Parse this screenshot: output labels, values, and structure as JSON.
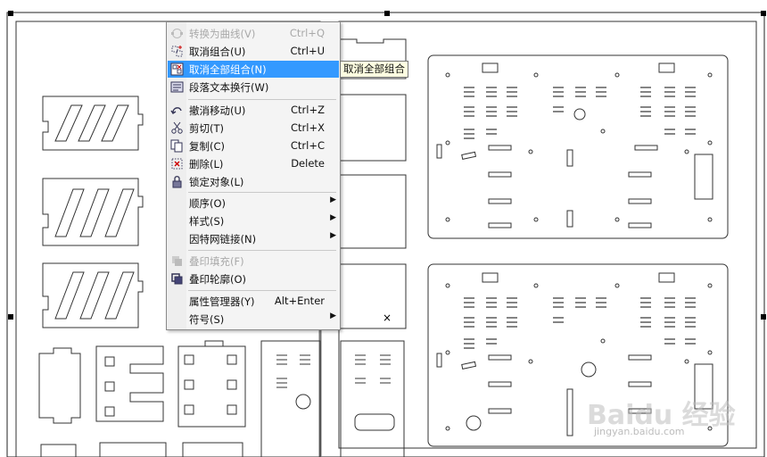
{
  "context_menu": {
    "items": [
      {
        "label": "转换为曲线(V)",
        "shortcut": "Ctrl+Q",
        "icon": "convert-curve-icon",
        "disabled": true
      },
      {
        "label": "取消组合(U)",
        "shortcut": "Ctrl+U",
        "icon": "ungroup-icon"
      },
      {
        "label": "取消全部组合(N)",
        "shortcut": "",
        "icon": "ungroup-all-icon",
        "highlighted": true
      },
      {
        "label": "段落文本换行(W)",
        "shortcut": "",
        "icon": "wrap-text-icon"
      },
      {
        "label": "撤消移动(U)",
        "shortcut": "Ctrl+Z",
        "icon": "undo-icon"
      },
      {
        "label": "剪切(T)",
        "shortcut": "Ctrl+X",
        "icon": "scissors-icon"
      },
      {
        "label": "复制(C)",
        "shortcut": "Ctrl+C",
        "icon": "copy-icon"
      },
      {
        "label": "删除(L)",
        "shortcut": "Delete",
        "icon": "delete-icon"
      },
      {
        "label": "锁定对象(L)",
        "shortcut": "",
        "icon": "lock-icon"
      },
      {
        "label": "顺序(O)",
        "submenu": true
      },
      {
        "label": "样式(S)",
        "submenu": true
      },
      {
        "label": "因特网链接(N)",
        "submenu": true
      },
      {
        "label": "叠印填充(F)",
        "shortcut": "",
        "icon": "overprint-fill-icon",
        "disabled": true
      },
      {
        "label": "叠印轮廓(O)",
        "shortcut": "",
        "icon": "overprint-outline-icon"
      },
      {
        "label": "属性管理器(Y)",
        "shortcut": "Alt+Enter"
      },
      {
        "label": "符号(S)",
        "submenu": true
      }
    ]
  },
  "tooltip": "取消全部组合",
  "watermark": {
    "brand": "Baidu 经验",
    "url": "jingyan.baidu.com"
  },
  "colors": {
    "highlight": "#3399ff",
    "menu_bg": "#f4f4f4",
    "tooltip_bg": "#ffffe1"
  }
}
